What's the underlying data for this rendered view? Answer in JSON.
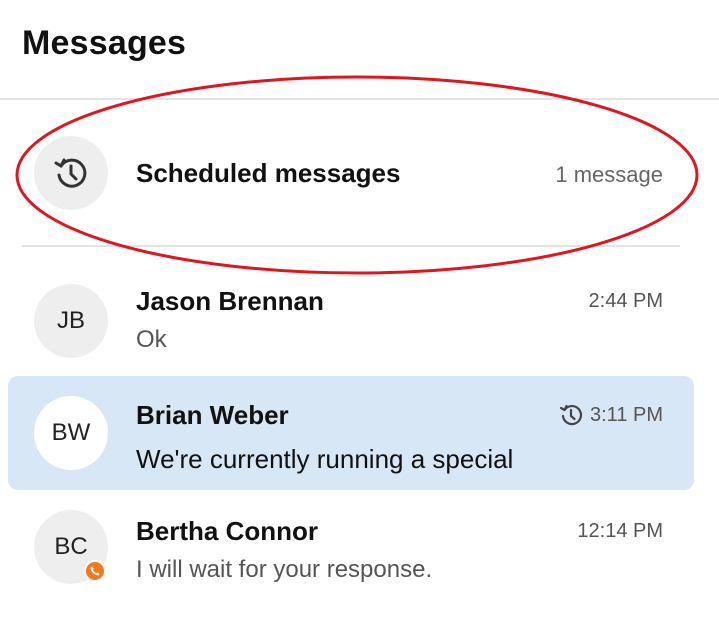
{
  "header": {
    "title": "Messages"
  },
  "scheduled": {
    "label": "Scheduled messages",
    "count": "1 message",
    "icon": "scheduled-clock-icon"
  },
  "conversations": [
    {
      "initials": "JB",
      "name": "Jason Brennan",
      "preview": "Ok",
      "time": "2:44 PM"
    },
    {
      "initials": "BW",
      "name": "Brian Weber",
      "preview": "We're currently running a special",
      "time": "3:11 PM",
      "scheduled": true,
      "selected": true
    },
    {
      "initials": "BC",
      "name": "Bertha Connor",
      "preview": "I will wait for your response.",
      "time": "12:14 PM",
      "badge": "phone-icon"
    }
  ],
  "colors": {
    "selected_bg": "#d8e7f5",
    "annotation_red": "#e0161e",
    "badge_orange": "#f07a1f"
  }
}
